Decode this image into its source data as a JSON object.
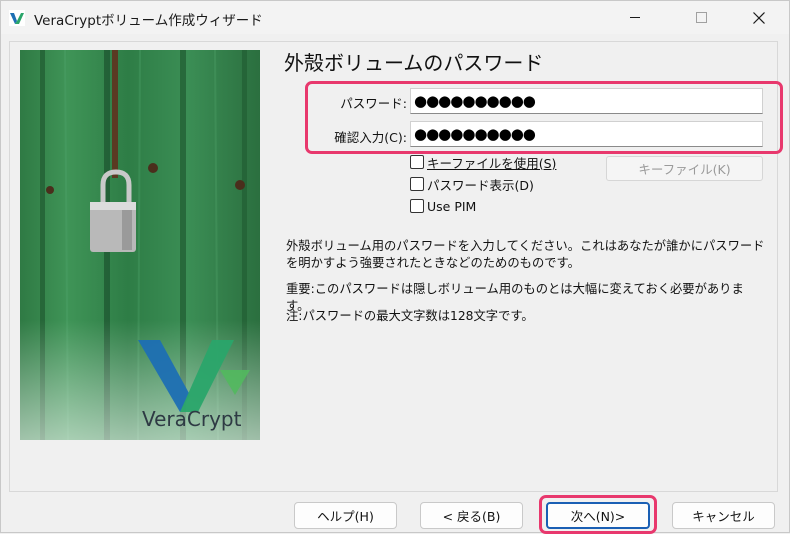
{
  "window": {
    "title": "VeraCryptボリューム作成ウィザード",
    "controls": {
      "minimize": "—",
      "maximize": "☐",
      "close": "✕"
    }
  },
  "banner": {
    "brand": "VeraCrypt",
    "image": "padlock-on-green-door"
  },
  "page": {
    "title": "外殻ボリュームのパスワード",
    "password_label": "パスワード:",
    "password_value": "●●●●●●●●●●",
    "confirm_label": "確認入力(C):",
    "confirm_value": "●●●●●●●●●●",
    "use_keyfiles_label": "キーファイルを使用(S)",
    "use_keyfiles_checked": false,
    "show_password_label": "パスワード表示(D)",
    "show_password_checked": false,
    "use_pim_label": "Use PIM",
    "use_pim_checked": false,
    "keyfiles_button": "キーファイル(K)",
    "info_1": "外殻ボリューム用のパスワードを入力してください。これはあなたが誰かにパスワードを明かすよう強要されたときなどのためのものです。",
    "info_2": "重要:このパスワードは隠しボリューム用のものとは大幅に変えておく必要があります。",
    "info_3": "注:パスワードの最大文字数は128文字です。"
  },
  "footer": {
    "help": "ヘルプ(H)",
    "back": "< 戻る(B)",
    "next": "次へ(N)>",
    "cancel": "キャンセル"
  },
  "colors": {
    "highlight": "#e8386d",
    "focus": "#1a5fb4"
  }
}
